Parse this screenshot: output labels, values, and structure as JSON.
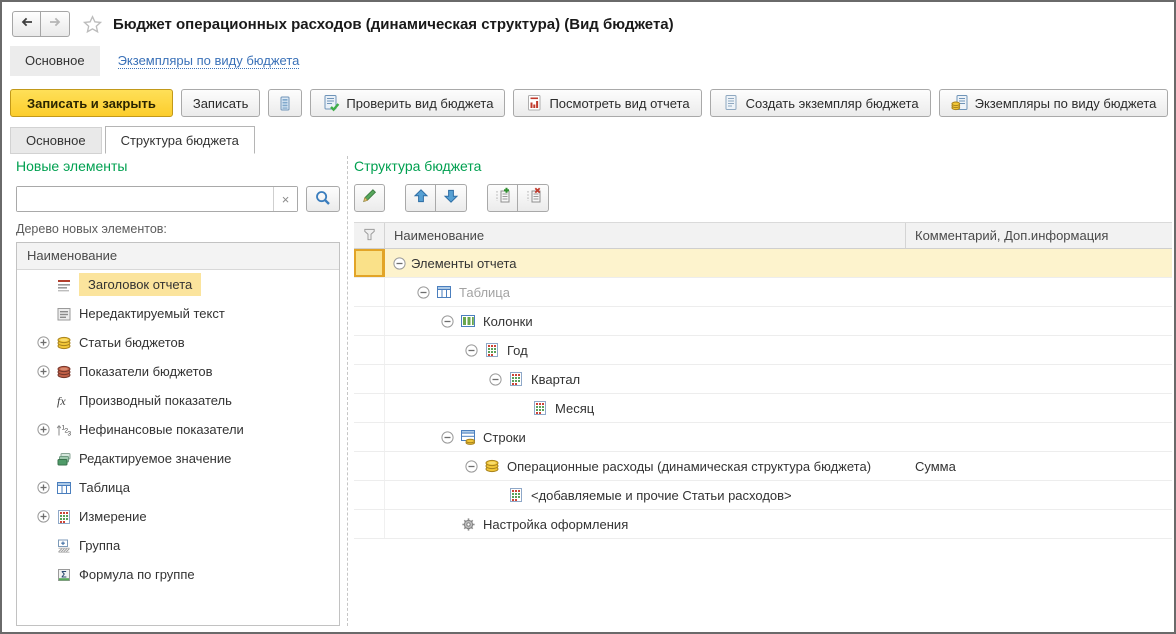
{
  "window": {
    "title": "Бюджет операционных расходов (динамическая структура) (Вид бюджета)"
  },
  "nav": {
    "section_tab": "Основное",
    "link": "Экземпляры по виду бюджета"
  },
  "toolbar": {
    "save_close": "Записать и закрыть",
    "save": "Записать",
    "check": "Проверить вид бюджета",
    "view_report": "Посмотреть вид отчета",
    "create_instance": "Создать экземпляр бюджета",
    "instances": "Экземпляры по виду бюджета"
  },
  "tabs": [
    {
      "label": "Основное",
      "active": false
    },
    {
      "label": "Структура бюджета",
      "active": true
    }
  ],
  "left_panel": {
    "title": "Новые элементы",
    "search_value": "",
    "tree_caption": "Дерево новых элементов:",
    "column_header": "Наименование",
    "items": [
      {
        "label": "Заголовок отчета",
        "icon": "report-title",
        "expandable": false,
        "selected": true
      },
      {
        "label": "Нередактируемый текст",
        "icon": "static-text",
        "expandable": false
      },
      {
        "label": "Статьи бюджетов",
        "icon": "coins-yellow",
        "expandable": true
      },
      {
        "label": "Показатели бюджетов",
        "icon": "coins-brown",
        "expandable": true
      },
      {
        "label": "Производный показатель",
        "icon": "fx",
        "expandable": false
      },
      {
        "label": "Нефинансовые показатели",
        "icon": "numbers",
        "expandable": true
      },
      {
        "label": "Редактируемое значение",
        "icon": "layers-green",
        "expandable": false
      },
      {
        "label": "Таблица",
        "icon": "table-blue",
        "expandable": true
      },
      {
        "label": "Измерение",
        "icon": "grid-colored",
        "expandable": true
      },
      {
        "label": "Группа",
        "icon": "group-plus",
        "expandable": false
      },
      {
        "label": "Формула по группе",
        "icon": "sigma",
        "expandable": false
      }
    ]
  },
  "right_panel": {
    "title": "Структура бюджета",
    "columns": [
      "Наименование",
      "Комментарий, Доп.информация"
    ],
    "rows": [
      {
        "label": "Элементы отчета",
        "level": 0,
        "expanded": true,
        "icon": null,
        "comment": "",
        "selected": true
      },
      {
        "label": "Таблица",
        "level": 1,
        "expanded": true,
        "icon": "table-blue",
        "comment": "",
        "muted": true
      },
      {
        "label": "Колонки",
        "level": 2,
        "expanded": true,
        "icon": "table-columns",
        "comment": ""
      },
      {
        "label": "Год",
        "level": 3,
        "expanded": true,
        "icon": "grid-colored",
        "comment": ""
      },
      {
        "label": "Квартал",
        "level": 4,
        "expanded": true,
        "icon": "grid-colored",
        "comment": ""
      },
      {
        "label": "Месяц",
        "level": 5,
        "icon": "grid-colored",
        "comment": ""
      },
      {
        "label": "Строки",
        "level": 2,
        "expanded": true,
        "icon": "table-rows-coin",
        "comment": ""
      },
      {
        "label": "Операционные расходы (динамическая структура бюджета)",
        "level": 3,
        "expanded": true,
        "icon": "coins-yellow",
        "comment": "Сумма"
      },
      {
        "label": "<добавляемые и прочие Статьи расходов>",
        "level": 4,
        "icon": "grid-colored",
        "comment": ""
      },
      {
        "label": "Настройка оформления",
        "level": 2,
        "icon": "gear",
        "comment": ""
      }
    ]
  }
}
